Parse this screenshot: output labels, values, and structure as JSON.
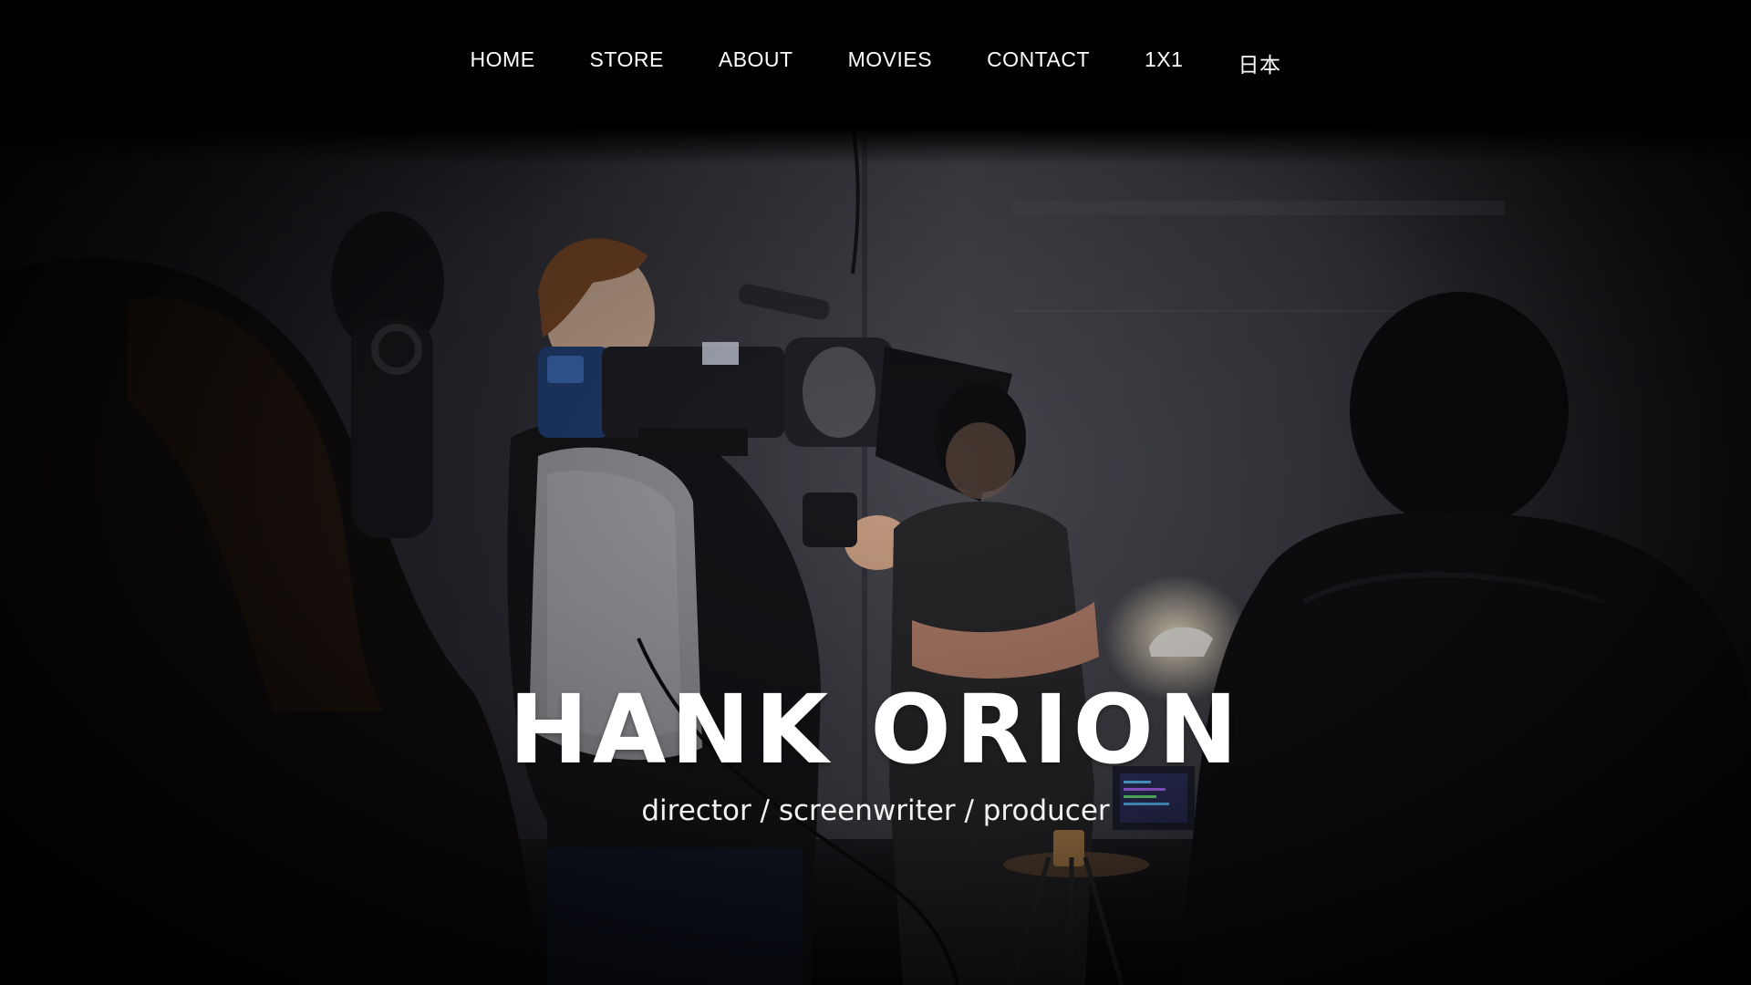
{
  "nav": {
    "items": [
      {
        "label": "HOME"
      },
      {
        "label": "STORE"
      },
      {
        "label": "ABOUT"
      },
      {
        "label": "MOVIES"
      },
      {
        "label": "CONTACT"
      },
      {
        "label": "1X1"
      },
      {
        "label": "日本"
      }
    ]
  },
  "hero": {
    "title": "HANK ORION",
    "subtitle": "director / screenwriter / producer",
    "image_subject": "film-crew-camera-operator-photo"
  },
  "colors": {
    "background": "#000000",
    "text": "#ffffff"
  }
}
